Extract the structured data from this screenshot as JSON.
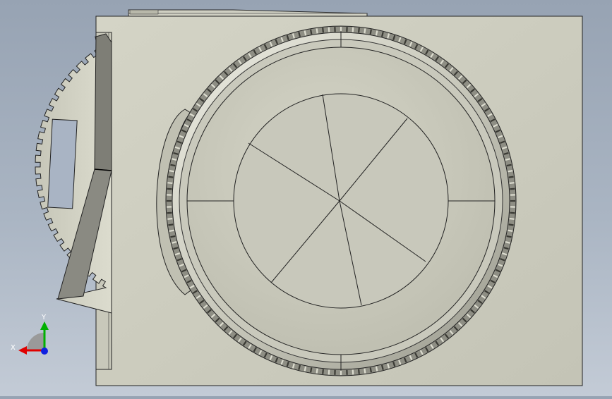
{
  "viewport": {
    "background_top": "#97a3b3",
    "background_bottom": "#c3cbd6",
    "model_face_color": "#cfcfc0",
    "edge_color": "#1a1a1a"
  },
  "triad": {
    "x_label": "X",
    "y_label": "Y",
    "x_color": "#e00000",
    "y_color": "#00b000",
    "z_color": "#1020e0"
  }
}
